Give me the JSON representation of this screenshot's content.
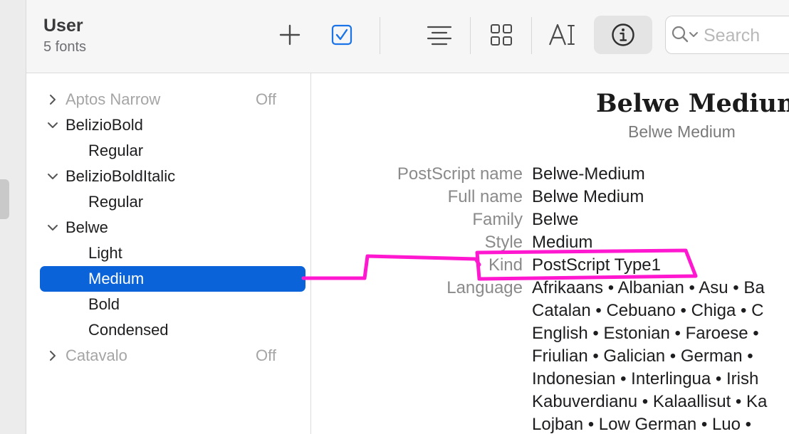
{
  "toolbar": {
    "title": "User",
    "subtitle": "5 fonts",
    "buttons": [
      {
        "name": "add-icon"
      },
      {
        "name": "checkbox-icon"
      },
      {
        "name": "align-center-icon"
      },
      {
        "name": "grid-icon"
      },
      {
        "name": "text-sample-icon"
      },
      {
        "name": "info-icon"
      }
    ],
    "search": {
      "placeholder": "Search",
      "icon": "search-icon"
    }
  },
  "sidebar": {
    "rows": [
      {
        "label": "Aptos Narrow",
        "status": "Off",
        "kind": "family",
        "expanded": false,
        "disabled": true
      },
      {
        "label": "BelizioBold",
        "kind": "family",
        "expanded": true
      },
      {
        "label": "Regular",
        "kind": "face"
      },
      {
        "label": "BelizioBoldItalic",
        "kind": "family",
        "expanded": true
      },
      {
        "label": "Regular",
        "kind": "face"
      },
      {
        "label": "Belwe",
        "kind": "family",
        "expanded": true
      },
      {
        "label": "Light",
        "kind": "face"
      },
      {
        "label": "Medium",
        "kind": "face",
        "selected": true
      },
      {
        "label": "Bold",
        "kind": "face"
      },
      {
        "label": "Condensed",
        "kind": "face"
      },
      {
        "label": "Catavalo",
        "status": "Off",
        "kind": "family",
        "expanded": false,
        "disabled": true
      }
    ]
  },
  "detail": {
    "title": "Belwe Medium",
    "subtitle": "Belwe Medium",
    "properties": [
      {
        "label": "PostScript name",
        "value": "Belwe-Medium"
      },
      {
        "label": "Full name",
        "value": "Belwe Medium"
      },
      {
        "label": "Family",
        "value": "Belwe"
      },
      {
        "label": "Style",
        "value": "Medium"
      },
      {
        "label": "Kind",
        "value": "PostScript Type1"
      }
    ],
    "language_label": "Language",
    "language_lines": [
      "Afrikaans • Albanian • Asu • Ba",
      "Catalan • Cebuano • Chiga • C",
      "English • Estonian • Faroese • ",
      "Friulian • Galician • German • ",
      "Indonesian • Interlingua • Irish",
      "Kabuverdianu • Kalaallisut • Ka",
      "Lojban • Low German • Luo • "
    ]
  },
  "colors": {
    "selection": "#0a63d9",
    "accent": "#1a73e8",
    "annotation": "#ff18d0"
  }
}
